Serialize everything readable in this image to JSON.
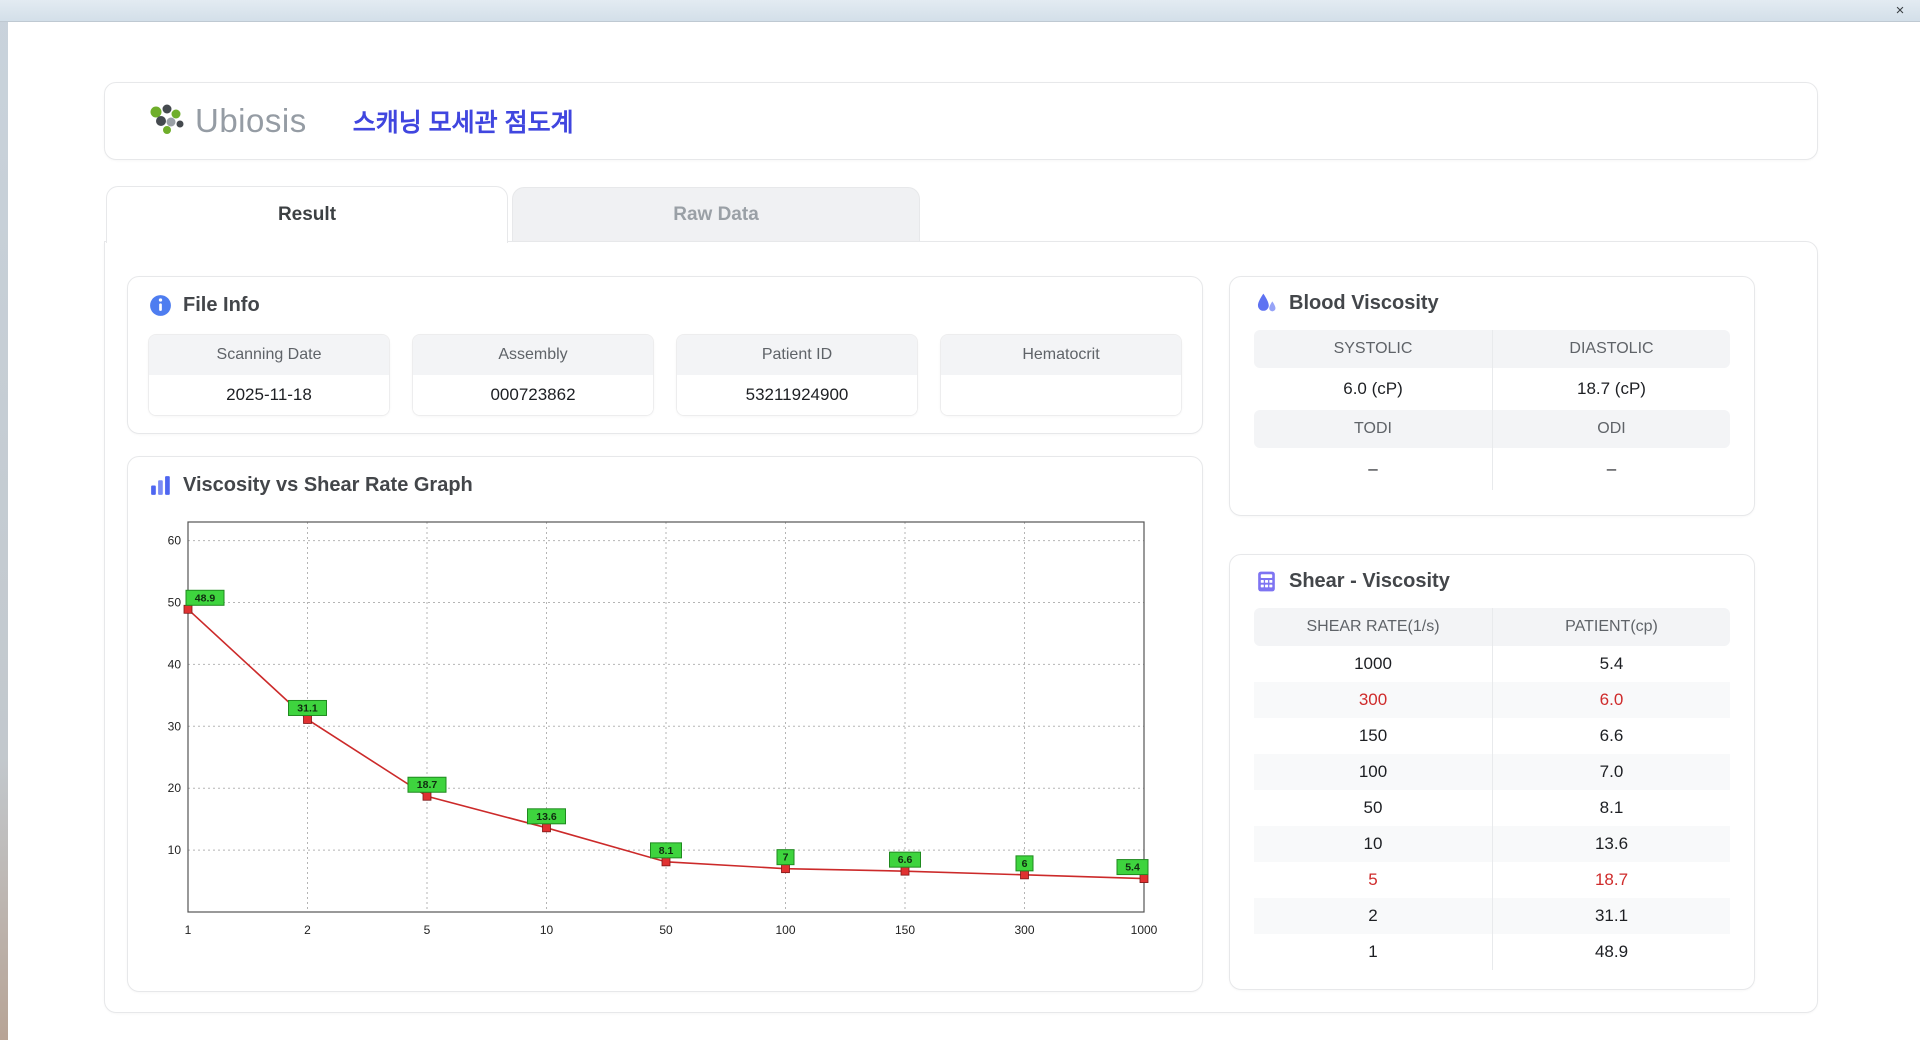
{
  "window": {
    "close_label": "×"
  },
  "header": {
    "logo_text": "Ubiosis",
    "title": "스캐닝 모세관 점도계"
  },
  "tabs": {
    "result": "Result",
    "raw_data": "Raw Data"
  },
  "file_info": {
    "title": "File Info",
    "fields": [
      {
        "label": "Scanning Date",
        "value": "2025-11-18"
      },
      {
        "label": "Assembly",
        "value": "000723862"
      },
      {
        "label": "Patient ID",
        "value": "53211924900"
      },
      {
        "label": "Hematocrit",
        "value": ""
      }
    ]
  },
  "blood_viscosity": {
    "title": "Blood Viscosity",
    "systolic_label": "SYSTOLIC",
    "diastolic_label": "DIASTOLIC",
    "systolic_value": "6.0 (cP)",
    "diastolic_value": "18.7 (cP)",
    "todi_label": "TODI",
    "odi_label": "ODI",
    "todi_value": "–",
    "odi_value": "–"
  },
  "shear_table": {
    "title": "Shear - Viscosity",
    "columns": [
      "SHEAR RATE(1/s)",
      "PATIENT(cp)"
    ],
    "rows": [
      {
        "shear": "1000",
        "patient": "5.4",
        "highlight": false
      },
      {
        "shear": "300",
        "patient": "6.0",
        "highlight": true
      },
      {
        "shear": "150",
        "patient": "6.6",
        "highlight": false
      },
      {
        "shear": "100",
        "patient": "7.0",
        "highlight": false
      },
      {
        "shear": "50",
        "patient": "8.1",
        "highlight": false
      },
      {
        "shear": "10",
        "patient": "13.6",
        "highlight": false
      },
      {
        "shear": "5",
        "patient": "18.7",
        "highlight": true
      },
      {
        "shear": "2",
        "patient": "31.1",
        "highlight": false
      },
      {
        "shear": "1",
        "patient": "48.9",
        "highlight": false
      }
    ]
  },
  "graph": {
    "title": "Viscosity vs Shear Rate Graph"
  },
  "chart_data": {
    "type": "line",
    "title": "Viscosity vs Shear Rate Graph",
    "x": [
      1,
      2,
      5,
      10,
      50,
      100,
      150,
      300,
      1000
    ],
    "values": [
      48.9,
      31.1,
      18.7,
      13.6,
      8.1,
      7,
      6.6,
      6,
      5.4
    ],
    "point_labels": [
      "48.9",
      "31.1",
      "18.7",
      "13.6",
      "8.1",
      "7",
      "6.6",
      "6",
      "5.4"
    ],
    "x_ticks": [
      "1",
      "2",
      "5",
      "10",
      "50",
      "100",
      "150",
      "300",
      "1000"
    ],
    "y_ticks": [
      10,
      20,
      30,
      40,
      50,
      60
    ],
    "ylim": [
      0,
      63
    ],
    "x_scale": "categorical-even",
    "grid": true,
    "xlabel": "",
    "ylabel": "",
    "line_color": "#cc2a2a",
    "marker_color": "#e03131",
    "label_bg": "#3ed43e"
  }
}
